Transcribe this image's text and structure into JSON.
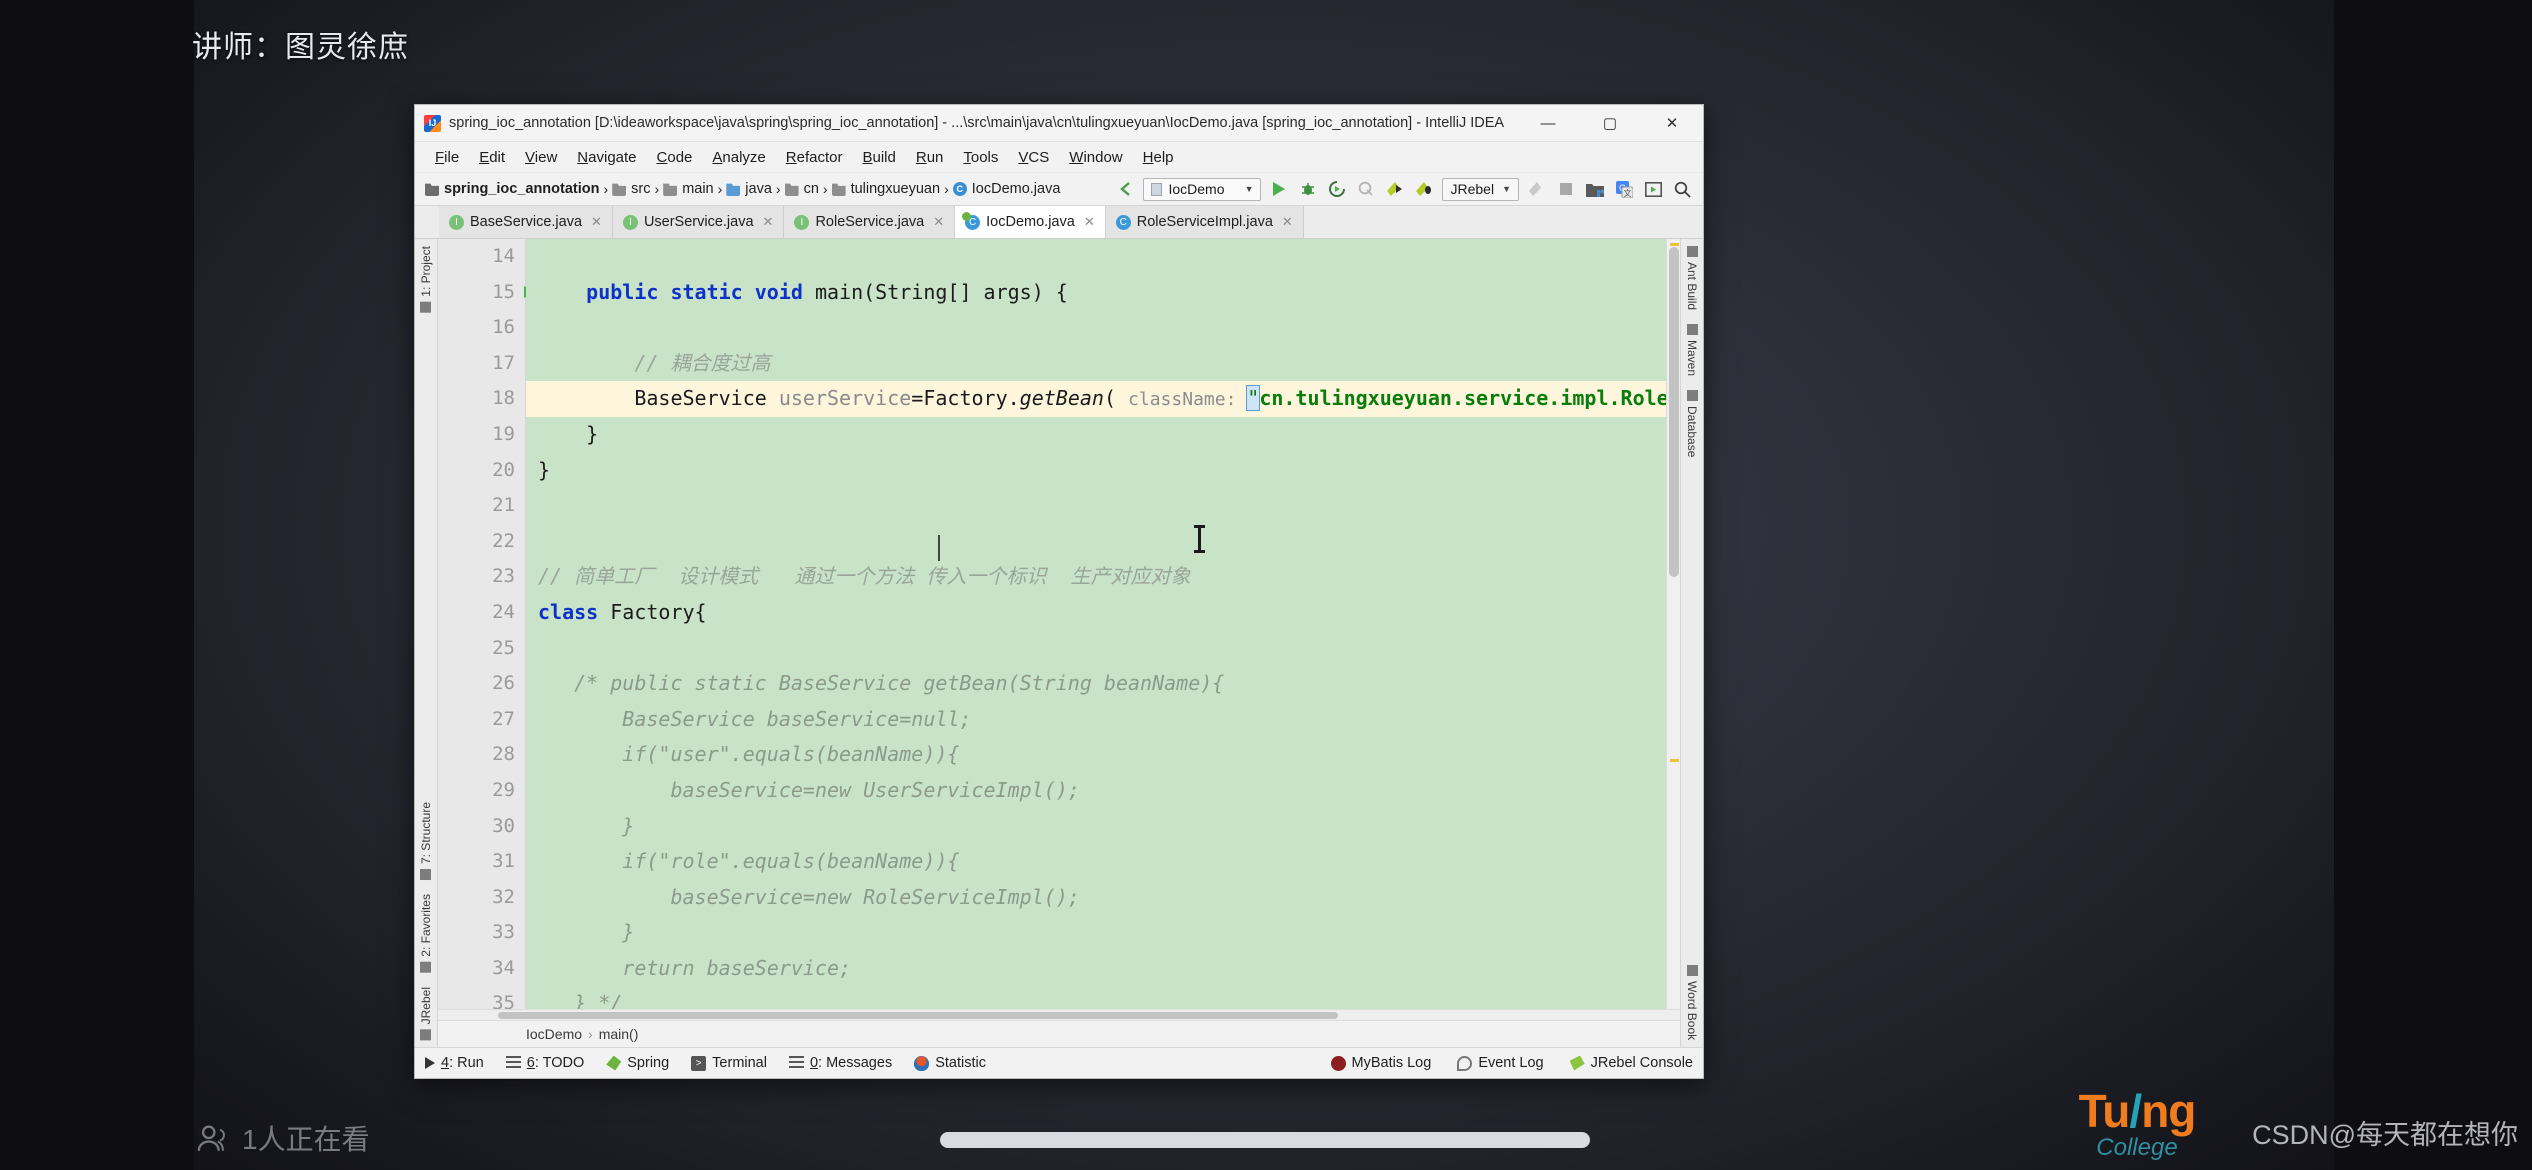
{
  "overlay": {
    "lecturer": "讲师：图灵徐庶",
    "viewers": "1人正在看",
    "viewers_icon": "viewers-icon",
    "brand_line1_a": "Tu",
    "brand_line1_slash": "/",
    "brand_line1_b": "ng",
    "brand_line2": "College",
    "watermark": "CSDN@每天都在想你"
  },
  "window": {
    "title": "spring_ioc_annotation [D:\\ideaworkspace\\java\\spring\\spring_ioc_annotation] - ...\\src\\main\\java\\cn\\tulingxueyuan\\IocDemo.java [spring_ioc_annotation] - IntelliJ IDEA",
    "minimize": "—",
    "maximize": "▢",
    "close": "✕"
  },
  "menu": {
    "items": [
      "File",
      "Edit",
      "View",
      "Navigate",
      "Code",
      "Analyze",
      "Refactor",
      "Build",
      "Run",
      "Tools",
      "VCS",
      "Window",
      "Help"
    ]
  },
  "navbar": {
    "breadcrumbs": [
      {
        "label": "spring_ioc_annotation",
        "icon": "module-icon",
        "bold": true
      },
      {
        "label": "src",
        "icon": "folder-icon-grey",
        "bold": false
      },
      {
        "label": "main",
        "icon": "folder-icon-grey",
        "bold": false
      },
      {
        "label": "java",
        "icon": "folder-icon-blue",
        "bold": false
      },
      {
        "label": "cn",
        "icon": "package-icon",
        "bold": false
      },
      {
        "label": "tulingxueyuan",
        "icon": "package-icon",
        "bold": false
      },
      {
        "label": "IocDemo.java",
        "icon": "class-icon-blue",
        "bold": false
      }
    ],
    "run_config": "IocDemo",
    "jrebel_label": "JRebel",
    "icons": [
      "back-arrow-icon",
      "run-icon",
      "debug-icon",
      "run-with-coverage-icon",
      "profile-icon",
      "jrebel-run-icon",
      "jrebel-debug-icon",
      "attach-icon",
      "stop-icon",
      "project-structure-icon",
      "translate-icon",
      "presentation-icon",
      "search-icon"
    ]
  },
  "editor_tabs": [
    {
      "label": "BaseService.java",
      "icon": "interface-icon",
      "active": false
    },
    {
      "label": "UserService.java",
      "icon": "interface-icon",
      "active": false
    },
    {
      "label": "RoleService.java",
      "icon": "interface-icon",
      "active": false
    },
    {
      "label": "IocDemo.java",
      "icon": "class-icon-spring",
      "active": true
    },
    {
      "label": "RoleServiceImpl.java",
      "icon": "class-icon",
      "active": false
    }
  ],
  "left_tool_strip": [
    {
      "label": "1: Project",
      "icon": "project-folder-icon"
    },
    {
      "label": "7: Structure",
      "icon": "structure-icon"
    },
    {
      "label": "2: Favorites",
      "icon": "star-icon"
    },
    {
      "label": "JRebel",
      "icon": "jrebel-icon"
    }
  ],
  "right_tool_strip": [
    {
      "label": "Ant Build",
      "icon": "ant-icon"
    },
    {
      "label": "Maven",
      "icon": "maven-icon"
    },
    {
      "label": "Database",
      "icon": "database-icon"
    },
    {
      "label": "Word Book",
      "icon": "book-icon"
    }
  ],
  "code": {
    "first_line_number": 14,
    "lines": [
      {
        "n": 14,
        "segments": [],
        "caret": false,
        "runmark": false,
        "fold": ""
      },
      {
        "n": 15,
        "segments": [
          {
            "t": "    ",
            "c": "pl"
          },
          {
            "t": "public static void ",
            "c": "kw"
          },
          {
            "t": "main(String[] args) {",
            "c": "pl"
          }
        ],
        "caret": false,
        "runmark": true,
        "fold": "▽"
      },
      {
        "n": 16,
        "segments": [],
        "caret": false,
        "runmark": false,
        "fold": ""
      },
      {
        "n": 17,
        "segments": [
          {
            "t": "        // 耦合度过高",
            "c": "cm"
          }
        ],
        "caret": false,
        "runmark": false,
        "fold": ""
      },
      {
        "n": 18,
        "segments": [
          {
            "t": "        BaseService ",
            "c": "pl"
          },
          {
            "t": "userService",
            "c": "field"
          },
          {
            "t": "=Factory.",
            "c": "pl"
          },
          {
            "t": "getBean",
            "c": "mth"
          },
          {
            "t": "( ",
            "c": "pl"
          },
          {
            "t": "className: ",
            "c": "hint"
          },
          {
            "t": "\"",
            "c": "strquote"
          },
          {
            "t": "cn.tulingxueyuan.service.impl.RoleSe",
            "c": "str"
          }
        ],
        "caret": true,
        "runmark": false,
        "fold": ""
      },
      {
        "n": 19,
        "segments": [
          {
            "t": "    }",
            "c": "pl"
          }
        ],
        "caret": false,
        "runmark": false,
        "fold": "△"
      },
      {
        "n": 20,
        "segments": [
          {
            "t": "}",
            "c": "pl"
          }
        ],
        "caret": false,
        "runmark": false,
        "fold": "△"
      },
      {
        "n": 21,
        "segments": [],
        "caret": false,
        "runmark": false,
        "fold": ""
      },
      {
        "n": 22,
        "segments": [],
        "caret": false,
        "runmark": false,
        "fold": ""
      },
      {
        "n": 23,
        "segments": [
          {
            "t": "// 简单工厂  设计模式   通过一个方法 传入一个标识  生产对应对象",
            "c": "cm"
          }
        ],
        "caret": false,
        "runmark": false,
        "fold": ""
      },
      {
        "n": 24,
        "segments": [
          {
            "t": "class ",
            "c": "kw"
          },
          {
            "t": "Factory{",
            "c": "pl"
          }
        ],
        "caret": false,
        "runmark": false,
        "fold": "▽"
      },
      {
        "n": 25,
        "segments": [],
        "caret": false,
        "runmark": false,
        "fold": ""
      },
      {
        "n": 26,
        "segments": [
          {
            "t": "   /* public static BaseService getBean(String beanName){",
            "c": "cmblock"
          }
        ],
        "caret": false,
        "runmark": false,
        "fold": "▽"
      },
      {
        "n": 27,
        "segments": [
          {
            "t": "       BaseService baseService=null;",
            "c": "cmblock"
          }
        ],
        "caret": false,
        "runmark": false,
        "fold": ""
      },
      {
        "n": 28,
        "segments": [
          {
            "t": "       if(\"user\".equals(beanName)){",
            "c": "cmblock"
          }
        ],
        "caret": false,
        "runmark": false,
        "fold": ""
      },
      {
        "n": 29,
        "segments": [
          {
            "t": "           baseService=new UserServiceImpl();",
            "c": "cmblock"
          }
        ],
        "caret": false,
        "runmark": false,
        "fold": ""
      },
      {
        "n": 30,
        "segments": [
          {
            "t": "       }",
            "c": "cmblock"
          }
        ],
        "caret": false,
        "runmark": false,
        "fold": ""
      },
      {
        "n": 31,
        "segments": [
          {
            "t": "       if(\"role\".equals(beanName)){",
            "c": "cmblock"
          }
        ],
        "caret": false,
        "runmark": false,
        "fold": ""
      },
      {
        "n": 32,
        "segments": [
          {
            "t": "           baseService=new RoleServiceImpl();",
            "c": "cmblock"
          }
        ],
        "caret": false,
        "runmark": false,
        "fold": ""
      },
      {
        "n": 33,
        "segments": [
          {
            "t": "       }",
            "c": "cmblock"
          }
        ],
        "caret": false,
        "runmark": false,
        "fold": ""
      },
      {
        "n": 34,
        "segments": [
          {
            "t": "       return baseService;",
            "c": "cmblock"
          }
        ],
        "caret": false,
        "runmark": false,
        "fold": ""
      },
      {
        "n": 35,
        "segments": [
          {
            "t": "   } */",
            "c": "cmblock"
          }
        ],
        "caret": false,
        "runmark": false,
        "fold": "△"
      }
    ]
  },
  "editor_breadcrumb": {
    "class": "IocDemo",
    "separator": "›",
    "method": "main()"
  },
  "status_bar": {
    "left_items": [
      {
        "label": "4: Run",
        "mnemonic": "4",
        "icon": "run-icon"
      },
      {
        "label": "6: TODO",
        "mnemonic": "6",
        "icon": "todo-icon"
      },
      {
        "label": "Spring",
        "mnemonic": "",
        "icon": "spring-leaf-icon"
      },
      {
        "label": "Terminal",
        "mnemonic": "",
        "icon": "terminal-icon"
      },
      {
        "label": "0: Messages",
        "mnemonic": "0",
        "icon": "messages-icon"
      },
      {
        "label": "Statistic",
        "mnemonic": "",
        "icon": "statistic-icon"
      }
    ],
    "right_items": [
      {
        "label": "MyBatis Log",
        "icon": "mybatis-icon"
      },
      {
        "label": "Event Log",
        "icon": "event-log-icon"
      },
      {
        "label": "JRebel Console",
        "icon": "jrebel-icon"
      }
    ]
  },
  "colors": {
    "editor_bg": "#c9e3c9",
    "caret_line": "#fdf6dd",
    "keyword": "#0d31c9",
    "string": "#0a7d0a",
    "comment": "#9aa59a",
    "accent_green": "#6db33f"
  }
}
